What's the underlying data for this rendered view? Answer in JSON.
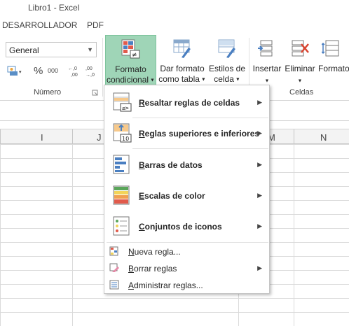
{
  "app": {
    "title": "Libro1 - Excel"
  },
  "ribbon_tabs": [
    "DESARROLLADOR",
    "PDF"
  ],
  "number_group": {
    "format_value": "General",
    "percent_symbol": "%",
    "thousands_symbol": "000",
    "decimals_increase": "←,0 ,00",
    "decimals_decrease": ",00 →,0",
    "label": "Número"
  },
  "styles_group": {
    "conditional_format": {
      "line1": "Formato",
      "line2": "condicional"
    },
    "format_as_table": {
      "line1": "Dar formato",
      "line2": "como tabla"
    },
    "cell_styles": {
      "line1": "Estilos de",
      "line2": "celda"
    }
  },
  "cells_group": {
    "insert": "Insertar",
    "delete": "Eliminar",
    "format": "Formato",
    "label": "Celdas"
  },
  "columns": [
    "I",
    "J",
    "M",
    "N"
  ],
  "menu": {
    "items_big": [
      {
        "label": "Resaltar reglas de celdas",
        "underline": "R",
        "rest": "esaltar reglas de celdas",
        "icon": "highlight-cells-rules-icon"
      },
      {
        "label": "Reglas superiores e inferiores",
        "underline": "R",
        "rest": "eglas superiores e inferiores",
        "icon": "top-bottom-rules-icon"
      },
      {
        "label": "Barras de datos",
        "underline": "B",
        "rest": "arras de datos",
        "icon": "data-bars-icon"
      },
      {
        "label": "Escalas de color",
        "underline": "E",
        "rest": "scalas de color",
        "icon": "color-scales-icon"
      },
      {
        "label": "Conjuntos de iconos",
        "underline": "C",
        "rest": "onjuntos de iconos",
        "icon": "icon-sets-icon"
      }
    ],
    "items_small": [
      {
        "label": "Nueva regla...",
        "underline": "N",
        "rest": "ueva regla...",
        "icon": "new-rule-icon"
      },
      {
        "label": "Borrar reglas",
        "underline": "B",
        "rest": "orrar reglas",
        "icon": "clear-rules-icon"
      },
      {
        "label": "Administrar reglas...",
        "underline": "A",
        "rest": "dministrar reglas...",
        "icon": "manage-rules-icon"
      }
    ]
  },
  "colors": {
    "active_button": "#9fd5b7",
    "excel_green": "#217346"
  }
}
